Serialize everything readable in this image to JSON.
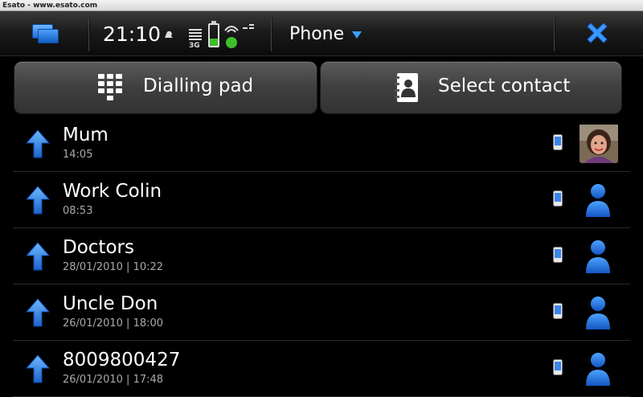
{
  "watermark": "Esato - www.esato.com",
  "statusbar": {
    "time": "21:10",
    "network": "3G",
    "app_menu": "Phone",
    "battery_level": 0.3
  },
  "actions": {
    "dialling_pad": "Dialling pad",
    "select_contact": "Select contact"
  },
  "calls": [
    {
      "name": "Mum",
      "time": "14:05",
      "direction": "outgoing",
      "number_type": "mobile",
      "avatar": "photo"
    },
    {
      "name": "Work Colin",
      "time": "08:53",
      "direction": "outgoing",
      "number_type": "mobile",
      "avatar": "placeholder"
    },
    {
      "name": "Doctors",
      "time": "28/01/2010 | 10:22",
      "direction": "outgoing",
      "number_type": "mobile",
      "avatar": "placeholder"
    },
    {
      "name": "Uncle Don",
      "time": "26/01/2010 | 18:00",
      "direction": "outgoing",
      "number_type": "mobile",
      "avatar": "placeholder"
    },
    {
      "name": "8009800427",
      "time": "26/01/2010 | 17:48",
      "direction": "outgoing",
      "number_type": "mobile",
      "avatar": "placeholder"
    }
  ],
  "colors": {
    "accent": "#2f7fe8",
    "battery": "#3fbf2a"
  }
}
